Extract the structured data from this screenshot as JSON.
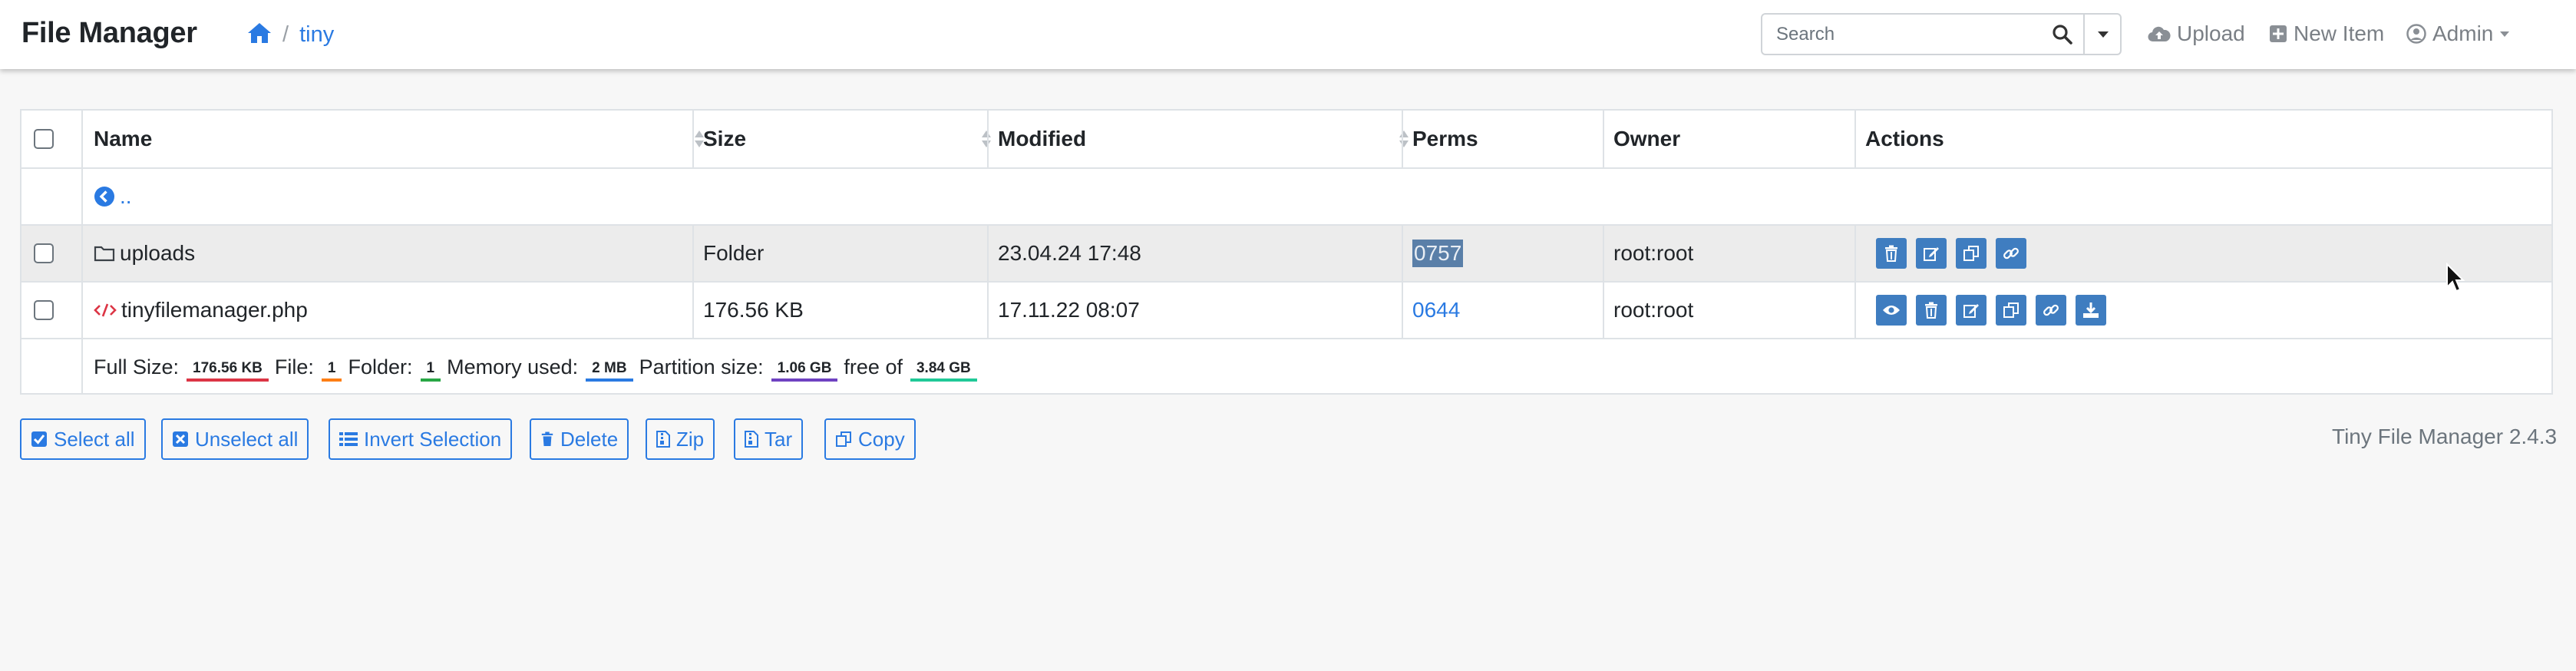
{
  "app": {
    "title": "File Manager"
  },
  "breadcrumb": {
    "separator": "/",
    "folder": "tiny"
  },
  "search": {
    "placeholder": "Search"
  },
  "nav": {
    "upload": "Upload",
    "new_item": "New Item",
    "user": "Admin"
  },
  "table": {
    "headers": {
      "name": "Name",
      "size": "Size",
      "modified": "Modified",
      "perms": "Perms",
      "owner": "Owner",
      "actions": "Actions"
    },
    "parent_link": "..",
    "rows": [
      {
        "name": "uploads",
        "size": "Folder",
        "modified": "23.04.24 17:48",
        "perms": "0757",
        "owner": "root:root",
        "type": "folder",
        "perms_selected": true,
        "actions": [
          "trash-icon",
          "edit-icon",
          "copy-icon",
          "link-icon"
        ]
      },
      {
        "name": "tinyfilemanager.php",
        "size": "176.56 KB",
        "modified": "17.11.22 08:07",
        "perms": "0644",
        "owner": "root:root",
        "type": "php",
        "actions": [
          "view-icon",
          "trash-icon",
          "edit-icon",
          "copy-icon",
          "link-icon",
          "download-icon"
        ]
      }
    ]
  },
  "summary": {
    "full_size_label": "Full Size:",
    "full_size": "176.56 KB",
    "file_label": "File:",
    "file_count": "1",
    "folder_label": "Folder:",
    "folder_count": "1",
    "memory_label": "Memory used:",
    "memory": "2 MB",
    "partition_label": "Partition size:",
    "partition": "1.06 GB",
    "free_label": "free of",
    "free_total": "3.84 GB"
  },
  "pill_colors": {
    "full_size": "#dc3545",
    "file": "#fd7e14",
    "folder": "#28a745",
    "memory": "#2a7ae2",
    "partition": "#6f42c1",
    "free_total": "#20c997"
  },
  "buttons": {
    "select_all": "Select all",
    "unselect_all": "Unselect all",
    "invert": "Invert Selection",
    "delete": "Delete",
    "zip": "Zip",
    "tar": "Tar",
    "copy": "Copy"
  },
  "version": "Tiny File Manager 2.4.3",
  "colors": {
    "accent": "#2a7ae2",
    "action_button": "#3f7dc0",
    "selection": "#5a7fa8"
  }
}
